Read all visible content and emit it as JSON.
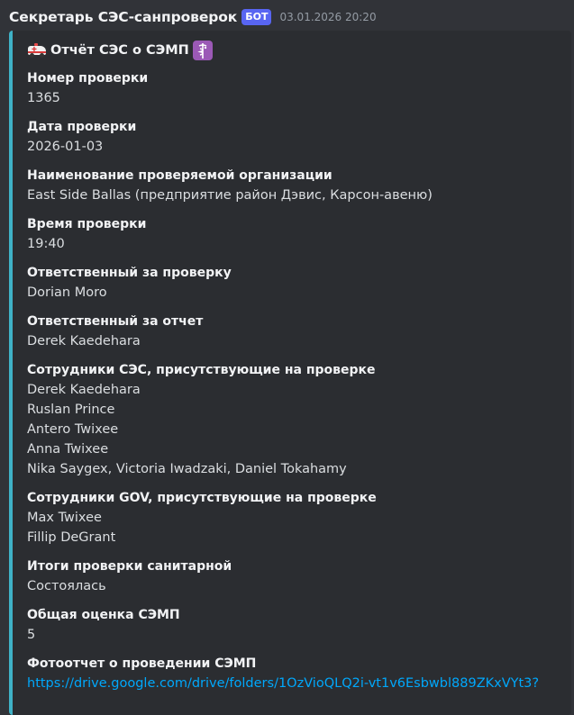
{
  "message": {
    "author": "Секретарь СЭС-санпроверок",
    "badge": "БОТ",
    "timestamp": "03.01.2026 20:20"
  },
  "embed": {
    "title": "Отчёт СЭС о СЭМП",
    "title_icons": [
      "ambulance-icon",
      "medical-symbol-icon"
    ],
    "accent_color": "#3fb2c7",
    "fields": [
      {
        "name": "Номер проверки",
        "lines": [
          "1365"
        ]
      },
      {
        "name": "Дата проверки",
        "lines": [
          "2026-01-03"
        ]
      },
      {
        "name": "Наименование проверяемой организации",
        "lines": [
          "East Side Ballas (предприятие район Дэвис, Карсон-авеню)"
        ]
      },
      {
        "name": "Время проверки",
        "lines": [
          "19:40"
        ]
      },
      {
        "name": "Ответственный за проверку",
        "lines": [
          "Dorian Moro"
        ]
      },
      {
        "name": "Ответственный за отчет",
        "lines": [
          "Derek Kaedehara"
        ]
      },
      {
        "name": "Сотрудники СЭС, присутствующие на проверке",
        "lines": [
          "Derek Kaedehara",
          "Ruslan Prince",
          "Antero Twixee",
          "Anna Twixee",
          "Nika Saygex, Victoria Iwadzaki, Daniel Tokahamy"
        ]
      },
      {
        "name": "Сотрудники GOV, присутствующие на проверке",
        "lines": [
          "Max Twixee",
          "Fillip DeGrant"
        ]
      },
      {
        "name": "Итоги проверки санитарной",
        "lines": [
          "Состоялась"
        ]
      },
      {
        "name": "Общая оценка СЭМП",
        "lines": [
          "5"
        ]
      },
      {
        "name": "Фотоотчет о проведении СЭМП",
        "link": "https://drive.google.com/drive/folders/1OzVioQLQ2i-vt1v6Esbwbl889ZKxVYt3?"
      }
    ]
  }
}
